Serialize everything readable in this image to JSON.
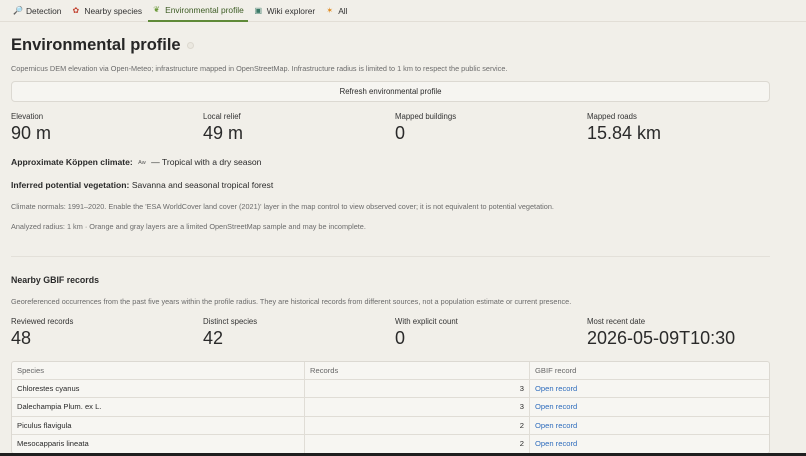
{
  "tabs": [
    {
      "label": "Detection",
      "icon": "magnifier-icon",
      "glyph": "🔎",
      "color": "blue"
    },
    {
      "label": "Nearby species",
      "icon": "flower-icon",
      "glyph": "✿",
      "color": "red"
    },
    {
      "label": "Environmental profile",
      "icon": "leaf-icon",
      "glyph": "❦",
      "color": "green",
      "active": true
    },
    {
      "label": "Wiki explorer",
      "icon": "book-icon",
      "glyph": "▣",
      "color": "teal"
    },
    {
      "label": "All",
      "icon": "sparkle-icon",
      "glyph": "✶",
      "color": "orange"
    }
  ],
  "page": {
    "title": "Environmental profile",
    "description": "Copernicus DEM elevation via Open-Meteo; infrastructure mapped in OpenStreetMap. Infrastructure radius is limited to 1 km to respect the public service.",
    "refresh_label": "Refresh environmental profile"
  },
  "metrics": [
    {
      "label": "Elevation",
      "value": "90 m"
    },
    {
      "label": "Local relief",
      "value": "49 m"
    },
    {
      "label": "Mapped buildings",
      "value": "0"
    },
    {
      "label": "Mapped roads",
      "value": "15.84 km"
    }
  ],
  "climate": {
    "koppen_label": "Approximate Köppen climate:",
    "koppen_code": "Aw",
    "koppen_value": "— Tropical with a dry season",
    "vegetation_label": "Inferred potential vegetation:",
    "vegetation_value": "Savanna and seasonal tropical forest",
    "normals_note": "Climate normals: 1991–2020. Enable the 'ESA WorldCover land cover (2021)' layer in the map control to view observed cover; it is not equivalent to potential vegetation.",
    "radius_note": "Analyzed radius: 1 km · Orange and gray layers are a limited OpenStreetMap sample and may be incomplete."
  },
  "gbif": {
    "title": "Nearby GBIF records",
    "description": "Georeferenced occurrences from the past five years within the profile radius. They are historical records from different sources, not a population estimate or current presence.",
    "metrics": [
      {
        "label": "Reviewed records",
        "value": "48"
      },
      {
        "label": "Distinct species",
        "value": "42"
      },
      {
        "label": "With explicit count",
        "value": "0"
      },
      {
        "label": "Most recent date",
        "value": "2026-05-09T10:30"
      }
    ],
    "columns": [
      "Species",
      "Records",
      "GBIF record"
    ],
    "rows": [
      {
        "species": "Chlorestes cyanus",
        "records": "3",
        "link": "Open record"
      },
      {
        "species": "Dalechampia Plum. ex L.",
        "records": "3",
        "link": "Open record"
      },
      {
        "species": "Piculus flavigula",
        "records": "2",
        "link": "Open record"
      },
      {
        "species": "Mesocapparis lineata",
        "records": "2",
        "link": "Open record"
      }
    ]
  }
}
